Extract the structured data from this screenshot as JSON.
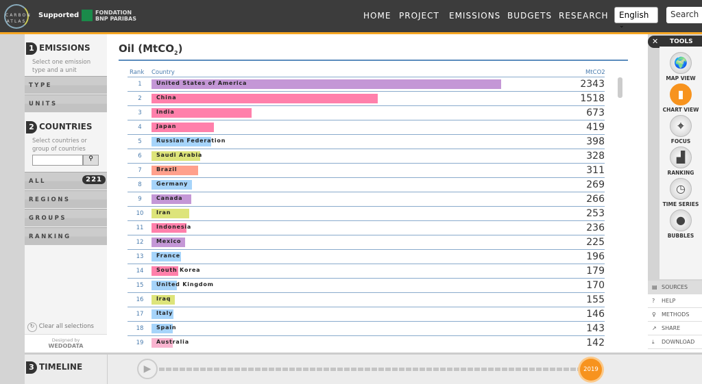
{
  "header": {
    "logo_text": "CARBON ATLAS",
    "supported_by": "Supported by",
    "sponsor": "FONDATION BNP PARIBAS",
    "nav": [
      "HOME",
      "PROJECT",
      "EMISSIONS",
      "BUDGETS",
      "RESEARCH"
    ],
    "language": "English",
    "search": "Search"
  },
  "sidebar": {
    "emissions": {
      "num": "1",
      "title": "EMISSIONS",
      "desc": "Select one emission type and a unit",
      "buttons": [
        "TYPE",
        "UNITS"
      ]
    },
    "countries": {
      "num": "2",
      "title": "COUNTRIES",
      "desc": "Select countries or group of countries",
      "search_value": "",
      "buttons": [
        "ALL",
        "REGIONS",
        "GROUPS",
        "RANKING"
      ],
      "all_count": "221"
    },
    "clear": "Clear all selections",
    "designed_by": "Designed by",
    "designer": "WEDODATA"
  },
  "timeline": {
    "num": "3",
    "title": "TIMELINE",
    "year": "2019"
  },
  "tools": {
    "title": "TOOLS",
    "items": [
      {
        "label": "MAP VIEW",
        "icon": "globe-icon"
      },
      {
        "label": "CHART VIEW",
        "icon": "bar-chart-icon",
        "active": true
      },
      {
        "label": "FOCUS",
        "icon": "crosshair-icon"
      },
      {
        "label": "RANKING",
        "icon": "podium-icon"
      },
      {
        "label": "TIME SERIES",
        "icon": "clock-icon"
      },
      {
        "label": "BUBBLES",
        "icon": "bubbles-icon"
      }
    ],
    "menu": [
      "SOURCES",
      "HELP",
      "METHODS",
      "SHARE",
      "DOWNLOAD"
    ]
  },
  "colors": {
    "accent": "#f7931e",
    "north_america": "#c497d6",
    "asia": "#ff80ab",
    "europe": "#a6d4fa",
    "middle_east": "#dde47a",
    "south_america": "#ffa08c",
    "oceania": "#f9b4cf"
  },
  "chart_data": {
    "type": "bar",
    "title": "Oil (MtCO2)",
    "columns": [
      "Rank",
      "Country",
      "MtCO2"
    ],
    "rows": [
      {
        "rank": "1",
        "country": "United States of America",
        "value": 2343,
        "region": "north_america"
      },
      {
        "rank": "2",
        "country": "China",
        "value": 1518,
        "region": "asia"
      },
      {
        "rank": "3",
        "country": "India",
        "value": 673,
        "region": "asia"
      },
      {
        "rank": "4",
        "country": "Japan",
        "value": 419,
        "region": "asia"
      },
      {
        "rank": "5",
        "country": "Russian Federation",
        "value": 398,
        "region": "europe"
      },
      {
        "rank": "6",
        "country": "Saudi Arabia",
        "value": 328,
        "region": "middle_east"
      },
      {
        "rank": "7",
        "country": "Brazil",
        "value": 311,
        "region": "south_america"
      },
      {
        "rank": "8",
        "country": "Germany",
        "value": 269,
        "region": "europe"
      },
      {
        "rank": "9",
        "country": "Canada",
        "value": 266,
        "region": "north_america"
      },
      {
        "rank": "10",
        "country": "Iran",
        "value": 253,
        "region": "middle_east"
      },
      {
        "rank": "11",
        "country": "Indonesia",
        "value": 236,
        "region": "asia"
      },
      {
        "rank": "12",
        "country": "Mexico",
        "value": 225,
        "region": "north_america"
      },
      {
        "rank": "13",
        "country": "France",
        "value": 196,
        "region": "europe"
      },
      {
        "rank": "14",
        "country": "South Korea",
        "value": 179,
        "region": "asia"
      },
      {
        "rank": "15",
        "country": "United Kingdom",
        "value": 170,
        "region": "europe"
      },
      {
        "rank": "16",
        "country": "Iraq",
        "value": 155,
        "region": "middle_east"
      },
      {
        "rank": "17",
        "country": "Italy",
        "value": 146,
        "region": "europe"
      },
      {
        "rank": "18",
        "country": "Spain",
        "value": 143,
        "region": "europe"
      },
      {
        "rank": "19",
        "country": "Australia",
        "value": 142,
        "region": "oceania"
      }
    ]
  }
}
